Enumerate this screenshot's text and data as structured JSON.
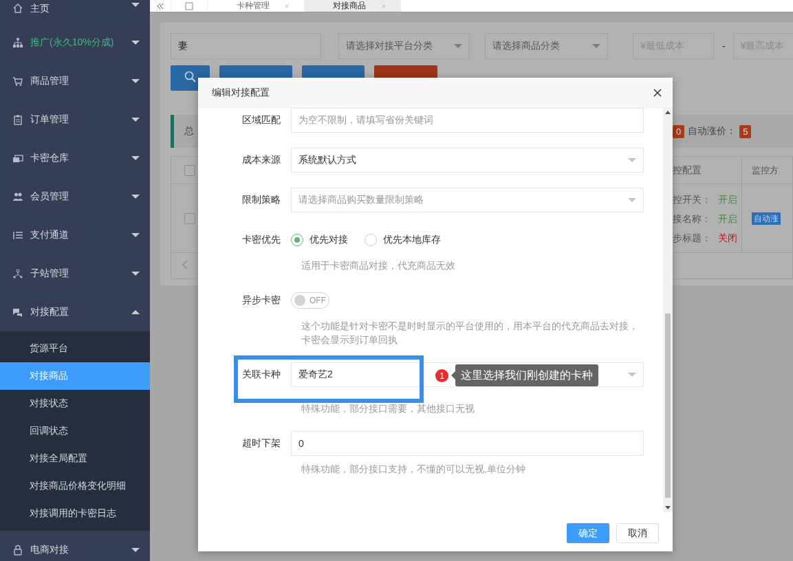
{
  "tab_bar": {
    "tabs": [
      {
        "label": "卡种管理",
        "close": "×",
        "selected": false
      },
      {
        "label": "对接商品",
        "close": "×",
        "selected": true
      }
    ]
  },
  "sidebar": {
    "items": [
      {
        "label": "主页",
        "kind": "menu",
        "expanded": false
      },
      {
        "label": "推广(永久10%分成)",
        "kind": "promo",
        "expanded": false
      },
      {
        "label": "商品管理",
        "kind": "menu",
        "expanded": false
      },
      {
        "label": "订单管理",
        "kind": "menu",
        "expanded": false
      },
      {
        "label": "卡密仓库",
        "kind": "menu",
        "expanded": false
      },
      {
        "label": "会员管理",
        "kind": "menu",
        "expanded": false
      },
      {
        "label": "支付通道",
        "kind": "menu",
        "expanded": false
      },
      {
        "label": "子站管理",
        "kind": "menu",
        "expanded": false
      },
      {
        "label": "对接配置",
        "kind": "menu",
        "expanded": true,
        "children": [
          {
            "label": "货源平台",
            "selected": false
          },
          {
            "label": "对接商品",
            "selected": true
          },
          {
            "label": "对接状态",
            "selected": false
          },
          {
            "label": "回调状态",
            "selected": false
          },
          {
            "label": "对接全局配置",
            "selected": false
          },
          {
            "label": "对接商品价格变化明细",
            "selected": false
          },
          {
            "label": "对接调用的卡密日志",
            "selected": false
          }
        ]
      },
      {
        "label": "电商对接",
        "kind": "menu",
        "expanded": false
      }
    ]
  },
  "filters": {
    "search": {
      "value": "妻"
    },
    "platform_select": {
      "placeholder": "请选择对接平台分类"
    },
    "category_select": {
      "placeholder": "请选择商品分类"
    },
    "min_cost": {
      "placeholder": "¥最低成本"
    },
    "range_separator": "-",
    "max_cost": {
      "placeholder": "¥最高成本"
    }
  },
  "toolbar": {
    "buttons": [
      {
        "kind": "primary"
      },
      {
        "kind": "primary"
      },
      {
        "kind": "danger"
      }
    ]
  },
  "stats": {
    "label": "总",
    "count_badge": "0",
    "auto_raise_label": "自动涨价：",
    "auto_raise_badge": "5"
  },
  "table": {
    "header_checked": false,
    "columns": [
      "控配置",
      "监控方"
    ],
    "rows": [
      {
        "checked": false,
        "monitor": [
          {
            "label": "控开关：",
            "value": "开启",
            "on": true
          },
          {
            "label": "接名称：",
            "value": "开启",
            "on": true
          },
          {
            "label": "步标题：",
            "value": "关闭",
            "on": false
          }
        ],
        "tag": "自动涨"
      }
    ]
  },
  "dialog": {
    "title": "编辑对接配置",
    "fields": [
      {
        "kind": "text",
        "label": "区域匹配",
        "placeholder": "为空不限制，请填写省份关键词"
      },
      {
        "kind": "select",
        "label": "成本来源",
        "value": "系统默认方式"
      },
      {
        "kind": "select",
        "label": "限制策略",
        "placeholder": "请选择商品购买数量限制策略"
      },
      {
        "kind": "radio",
        "label": "卡密优先",
        "options": [
          {
            "label": "优先对接",
            "selected": true
          },
          {
            "label": "优先本地库存",
            "selected": false
          }
        ],
        "hint": "适用于卡密商品对接，代充商品无效"
      },
      {
        "kind": "switch",
        "label": "异步卡密",
        "on": false,
        "state_text": "OFF",
        "hint": "这个功能是针对卡密不是时时显示的平台使用的，用本平台的代充商品去对接，卡密会显示到订单回执"
      },
      {
        "kind": "select",
        "label": "关联卡种",
        "value": "爱奇艺2",
        "hint": "特殊功能，部分接口需要，其他接口无视",
        "annotation": {
          "number": "1",
          "text": "这里选择我们刚创建的卡种"
        }
      },
      {
        "kind": "text",
        "label": "超时下架",
        "value": "0",
        "hint": "特殊功能，部分接口支持，不懂的可以无视,单位分钟"
      }
    ],
    "buttons": [
      {
        "label": "确定",
        "kind": "primary"
      },
      {
        "label": "取消",
        "kind": "default"
      }
    ]
  }
}
